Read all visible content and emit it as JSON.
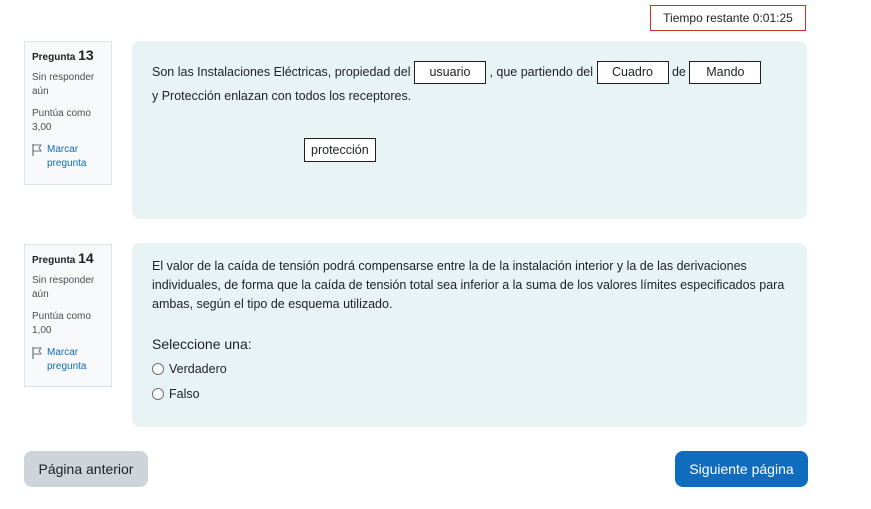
{
  "timer": {
    "label": "Tiempo restante",
    "value": "0:01:25",
    "text": "Tiempo restante 0:01:25"
  },
  "questions": [
    {
      "info": {
        "prefix": "Pregunta",
        "number": "13",
        "state": "Sin responder aún",
        "grade": "Puntúa como 3,00",
        "flag": "Marcar pregunta"
      },
      "text": {
        "part1": "Son las Instalaciones Eléctricas, propiedad del",
        "drop1": "usuario",
        "part2": ", que partiendo del",
        "drop2": "Cuadro",
        "part3": "de",
        "drop3": "Mando",
        "line2": "y Protección enlazan con todos los receptores."
      },
      "drag_items": [
        "protección"
      ]
    },
    {
      "info": {
        "prefix": "Pregunta",
        "number": "14",
        "state": "Sin responder aún",
        "grade": "Puntúa como 1,00",
        "flag": "Marcar pregunta"
      },
      "text": "El valor de la caída de tensión podrá compensarse entre la de la instalación interior y la de las derivaciones individuales, de forma que la caída de tensión total sea inferior a la suma de los valores límites especificados para ambas, según el tipo de esquema utilizado.",
      "prompt": "Seleccione una:",
      "options": [
        "Verdadero",
        "Falso"
      ]
    }
  ],
  "nav": {
    "prev": "Página anterior",
    "next": "Siguiente página"
  },
  "colors": {
    "accent": "#0f6cbf",
    "timer_border": "#ca3120",
    "question_bg": "#e7f3f5"
  }
}
